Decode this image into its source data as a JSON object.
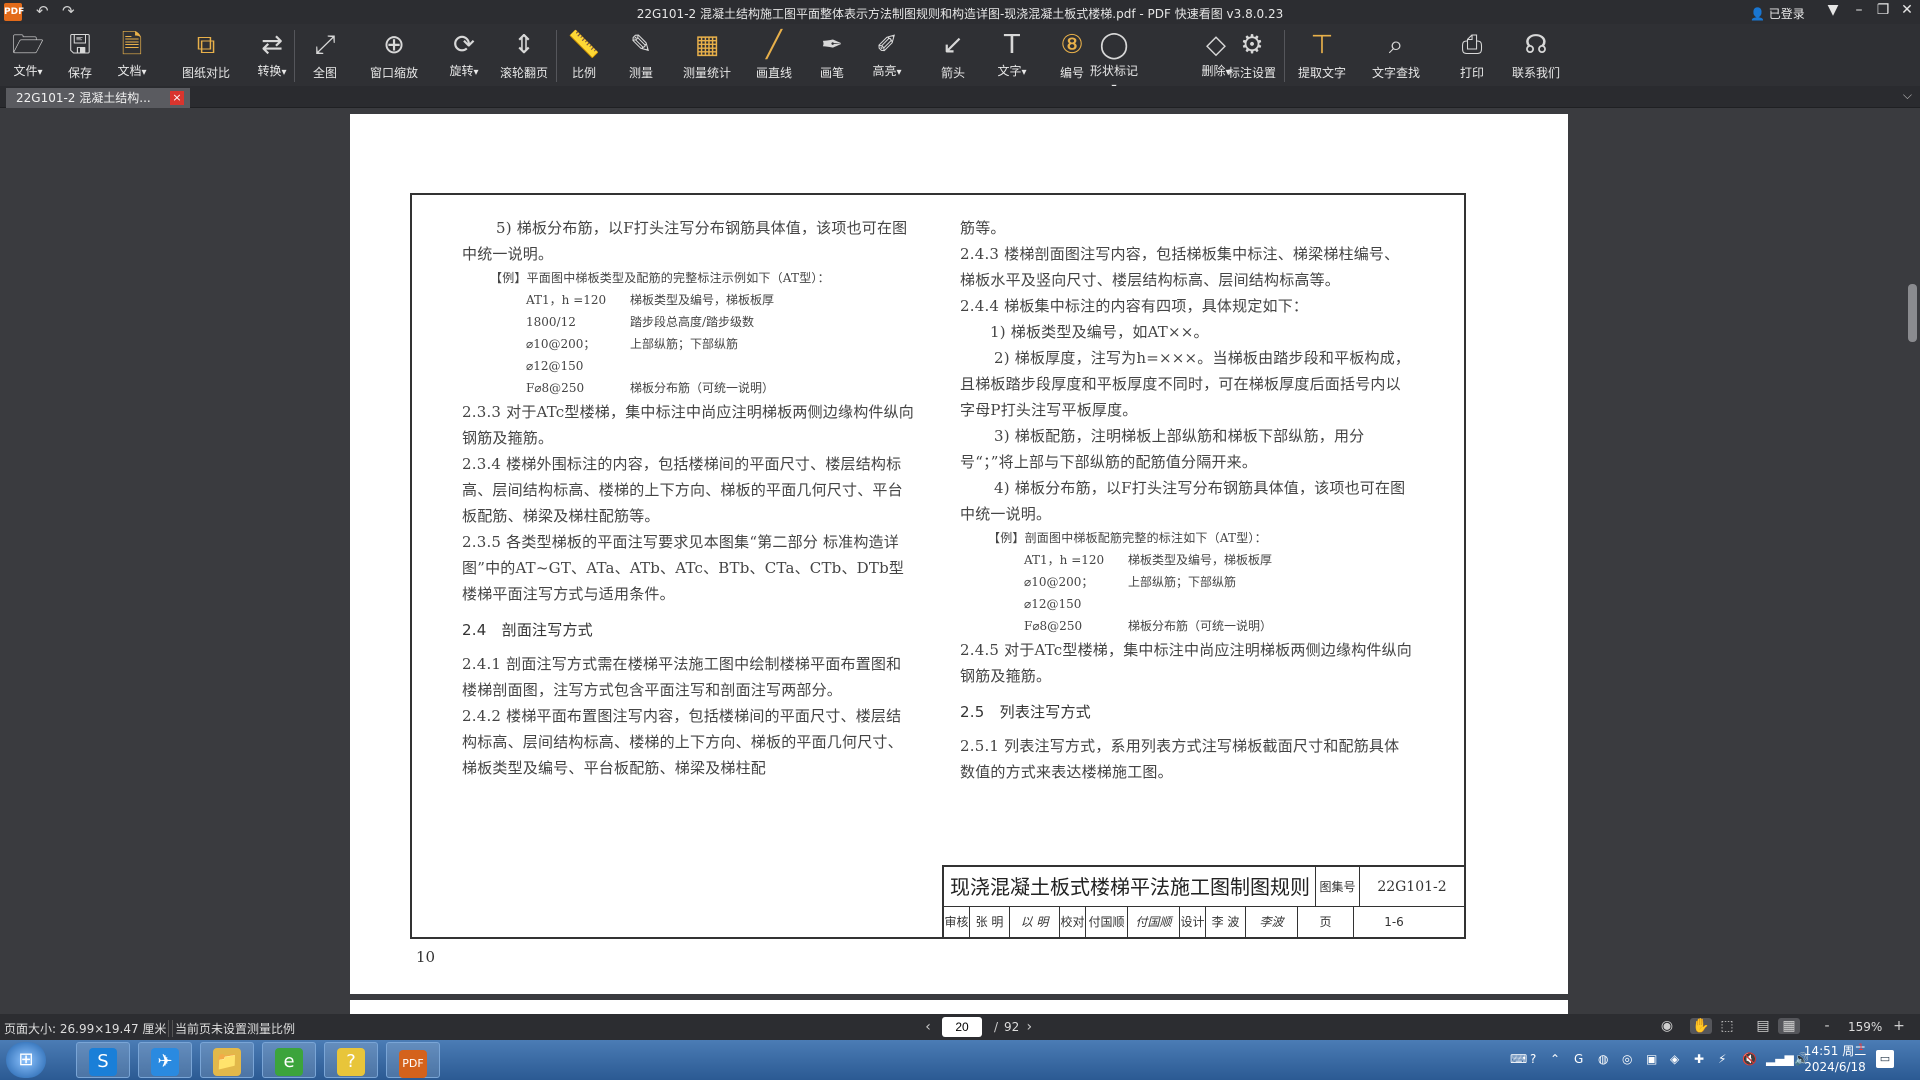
{
  "titlebar": {
    "title": "22G101-2 混凝土结构施工图平面整体表示方法制图规则和构造详图-现浇混凝土板式楼梯.pdf - PDF 快速看图 v3.8.0.23",
    "login": "已登录",
    "logo": "PDF"
  },
  "toolbar": [
    {
      "label": "文件",
      "icon": "folder-icon",
      "glyph": "🗁",
      "dropdown": true
    },
    {
      "label": "保存",
      "icon": "save-icon",
      "glyph": "🖫",
      "dropdown": false
    },
    {
      "label": "文档",
      "icon": "document-icon",
      "glyph": "🗎",
      "dropdown": true,
      "accent": true
    },
    {
      "label": "图纸对比",
      "icon": "compare-icon",
      "glyph": "⧉",
      "dropdown": false,
      "accent": true
    },
    {
      "label": "转换",
      "icon": "convert-icon",
      "glyph": "⇄",
      "dropdown": true
    },
    {
      "label": "全图",
      "icon": "fit-all-icon",
      "glyph": "⤢",
      "dropdown": false
    },
    {
      "label": "窗口缩放",
      "icon": "window-zoom-icon",
      "glyph": "⊕",
      "dropdown": false
    },
    {
      "label": "旋转",
      "icon": "rotate-icon",
      "glyph": "⟳",
      "dropdown": true
    },
    {
      "label": "滚轮翻页",
      "icon": "scroll-page-icon",
      "glyph": "⇕",
      "dropdown": false
    },
    {
      "label": "比例",
      "icon": "scale-icon",
      "glyph": "📏",
      "dropdown": false
    },
    {
      "label": "测量",
      "icon": "measure-icon",
      "glyph": "✎",
      "dropdown": false
    },
    {
      "label": "测量统计",
      "icon": "measure-stats-icon",
      "glyph": "▦",
      "dropdown": false,
      "accent": true
    },
    {
      "label": "画直线",
      "icon": "line-icon",
      "glyph": "╱",
      "dropdown": false,
      "accent": true
    },
    {
      "label": "画笔",
      "icon": "pen-icon",
      "glyph": "✒",
      "dropdown": false
    },
    {
      "label": "高亮",
      "icon": "highlight-icon",
      "glyph": "✐",
      "dropdown": true
    },
    {
      "label": "箭头",
      "icon": "arrow-icon",
      "glyph": "↙",
      "dropdown": false
    },
    {
      "label": "文字",
      "icon": "text-icon",
      "glyph": "T",
      "dropdown": true
    },
    {
      "label": "编号",
      "icon": "numbering-icon",
      "glyph": "⑧",
      "dropdown": false,
      "accent": true
    },
    {
      "label": "形状标记",
      "icon": "shape-mark-icon",
      "glyph": "◯",
      "dropdown": true
    },
    {
      "label": "删除",
      "icon": "erase-icon",
      "glyph": "◇",
      "dropdown": true
    },
    {
      "label": "标注设置",
      "icon": "annotation-settings-icon",
      "glyph": "⚙",
      "dropdown": false
    },
    {
      "label": "提取文字",
      "icon": "extract-text-icon",
      "glyph": "⊤",
      "dropdown": false,
      "accent": true
    },
    {
      "label": "文字查找",
      "icon": "search-icon",
      "glyph": "⌕",
      "dropdown": false
    },
    {
      "label": "打印",
      "icon": "print-icon",
      "glyph": "⎙",
      "dropdown": false
    },
    {
      "label": "联系我们",
      "icon": "headset-icon",
      "glyph": "☊",
      "dropdown": false
    }
  ],
  "tab": {
    "label": "22G101-2 混凝土结构...",
    "close": "×"
  },
  "document": {
    "left": [
      {
        "cls": "ind",
        "text": "5) 梯板分布筋，以F打头注写分布钢筋具体值，该项也可在图中统一说明。"
      },
      {
        "cls": "ex-title",
        "text": "【例】平面图中梯板类型及配筋的完整标注示例如下（AT型）："
      },
      {
        "cls": "ex-row",
        "a": "AT1，h =120",
        "b": "梯板类型及编号，梯板板厚"
      },
      {
        "cls": "ex-row",
        "a": "1800/12",
        "b": "踏步段总高度/踏步级数"
      },
      {
        "cls": "ex-row",
        "a": "⌀10@200；⌀12@150",
        "b": "上部纵筋；下部纵筋"
      },
      {
        "cls": "ex-row",
        "a": "F⌀8@250",
        "b": "梯板分布筋（可统一说明）"
      },
      {
        "cls": "para",
        "text": "2.3.3 对于ATc型楼梯，集中标注中尚应注明梯板两侧边缘构件纵向钢筋及箍筋。"
      },
      {
        "cls": "para",
        "text": "2.3.4 楼梯外围标注的内容，包括楼梯间的平面尺寸、楼层结构标高、层间结构标高、楼梯的上下方向、梯板的平面几何尺寸、平台板配筋、梯梁及梯柱配筋等。"
      },
      {
        "cls": "para",
        "text": "2.3.5 各类型梯板的平面注写要求见本图集“第二部分 标准构造详图”中的AT~GT、ATa、ATb、ATc、BTb、CTa、CTb、DTb型楼梯平面注写方式与适用条件。"
      },
      {
        "cls": "heading",
        "text": "2.4　剖面注写方式"
      },
      {
        "cls": "para",
        "text": "2.4.1 剖面注写方式需在楼梯平法施工图中绘制楼梯平面布置图和楼梯剖面图，注写方式包含平面注写和剖面注写两部分。"
      },
      {
        "cls": "para",
        "text": "2.4.2 楼梯平面布置图注写内容，包括楼梯间的平面尺寸、楼层结构标高、层间结构标高、楼梯的上下方向、梯板的平面几何尺寸、梯板类型及编号、平台板配筋、梯梁及梯柱配"
      }
    ],
    "right": [
      {
        "cls": "para",
        "text": "筋等。"
      },
      {
        "cls": "para",
        "text": "2.4.3 楼梯剖面图注写内容，包括梯板集中标注、梯梁梯柱编号、梯板水平及竖向尺寸、楼层结构标高、层间结构标高等。"
      },
      {
        "cls": "para",
        "text": "2.4.4 梯板集中标注的内容有四项，具体规定如下："
      },
      {
        "cls": "sub",
        "text": "1) 梯板类型及编号，如AT××。"
      },
      {
        "cls": "ind",
        "text": "2) 梯板厚度，注写为h=×××。当梯板由踏步段和平板构成，且梯板踏步段厚度和平板厚度不同时，可在梯板厚度后面括号内以字母P打头注写平板厚度。"
      },
      {
        "cls": "ind",
        "text": "3) 梯板配筋，注明梯板上部纵筋和梯板下部纵筋，用分号“；”将上部与下部纵筋的配筋值分隔开来。"
      },
      {
        "cls": "ind",
        "text": "4) 梯板分布筋，以F打头注写分布钢筋具体值，该项也可在图中统一说明。"
      },
      {
        "cls": "ex-title",
        "text": "【例】剖面图中梯板配筋完整的标注如下（AT型）："
      },
      {
        "cls": "ex-row",
        "a": "AT1，h =120",
        "b": "梯板类型及编号，梯板板厚"
      },
      {
        "cls": "ex-row",
        "a": "⌀10@200；⌀12@150",
        "b": "上部纵筋；下部纵筋"
      },
      {
        "cls": "ex-row",
        "a": "F⌀8@250",
        "b": "梯板分布筋（可统一说明）"
      },
      {
        "cls": "para",
        "text": "2.4.5 对于ATc型楼梯，集中标注中尚应注明梯板两侧边缘构件纵向钢筋及箍筋。"
      },
      {
        "cls": "heading",
        "text": "2.5　列表注写方式"
      },
      {
        "cls": "para",
        "text": "2.5.1 列表注写方式，系用列表方式注写梯板截面尺寸和配筋具体数值的方式来表达楼梯施工图。"
      }
    ],
    "titleblock": {
      "title": "现浇混凝土板式楼梯平法施工图制图规则",
      "atlas_label": "图集号",
      "atlas_no": "22G101-2",
      "cells": [
        "审核",
        "张 明",
        "以 明",
        "校对",
        "付国顺",
        "付国顺",
        "设计",
        "李 波",
        "李波",
        "页",
        "1-6"
      ]
    },
    "page_number": "10"
  },
  "status": {
    "page_size": "页面大小: 26.99×19.47 厘米",
    "scale_note": "当前页未设置测量比例",
    "current_page": "20",
    "total_pages": "92",
    "zoom": "159%"
  },
  "taskbar": {
    "time": "14:51 周二",
    "date": "2024/6/18",
    "badge": "1",
    "apps": [
      "sogou-browser-icon",
      "feishu-icon",
      "explorer-icon",
      "ie-icon",
      "help-icon",
      "pdf-viewer-icon"
    ]
  }
}
